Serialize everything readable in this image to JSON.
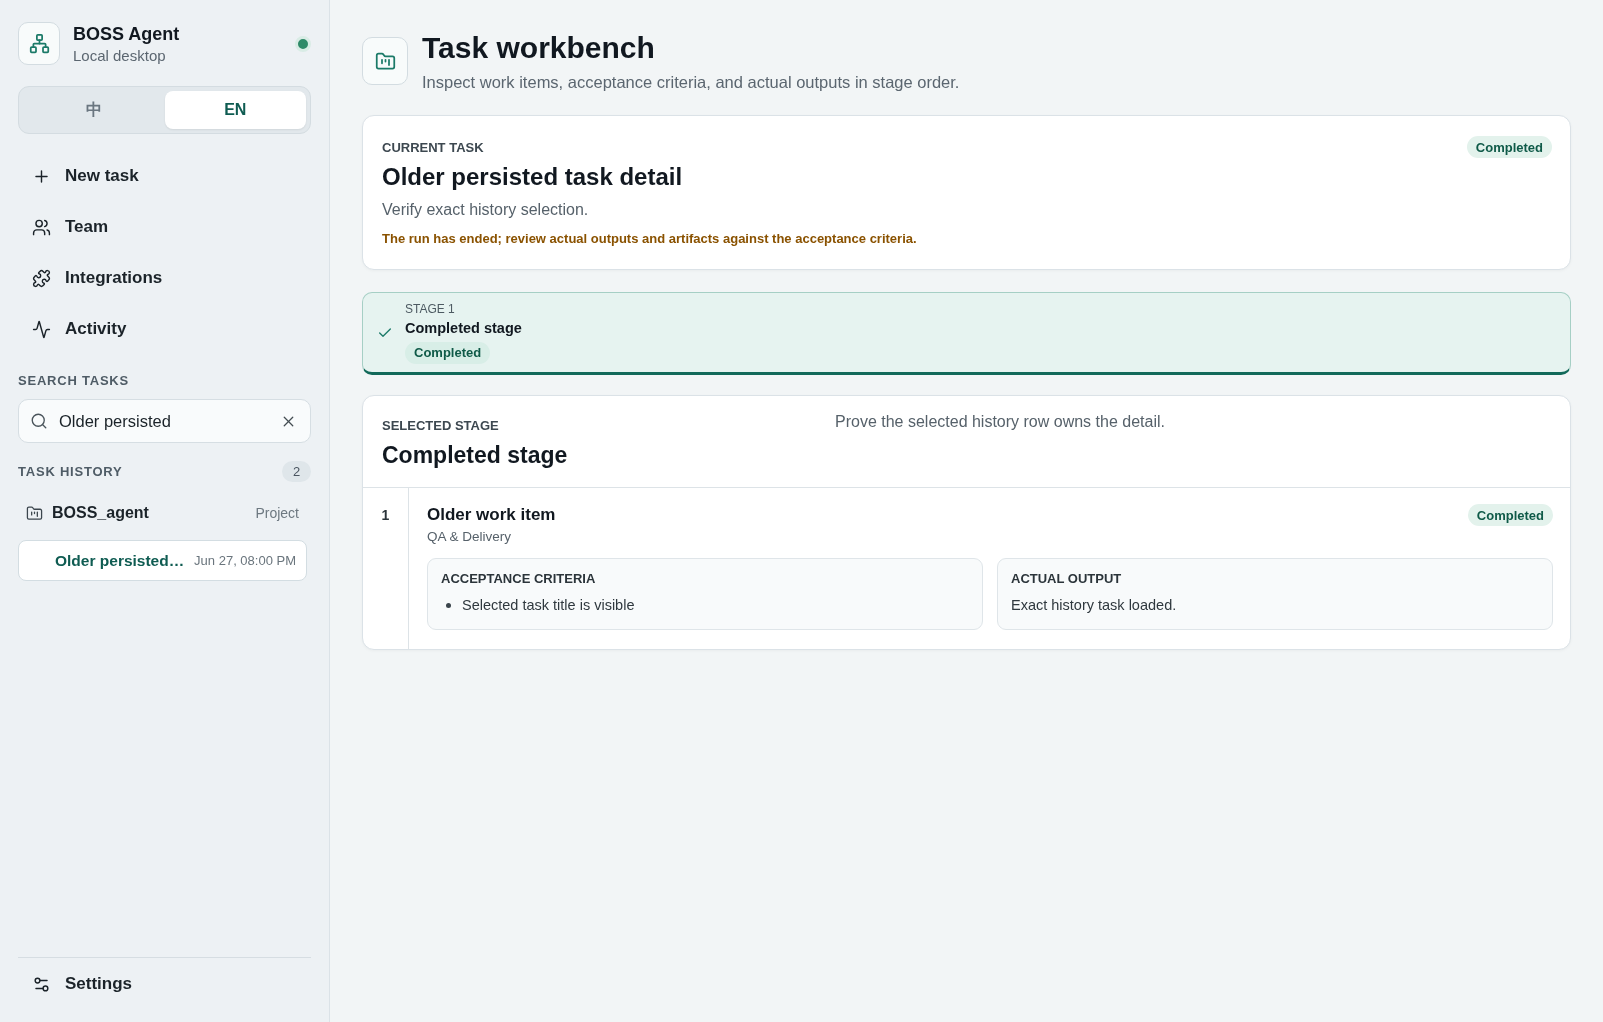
{
  "sidebar": {
    "brand": {
      "name": "BOSS Agent",
      "subtitle": "Local desktop",
      "online": true
    },
    "language_toggle": [
      {
        "label": "中",
        "selected": false
      },
      {
        "label": "EN",
        "selected": true
      }
    ],
    "nav": [
      {
        "label": "New task"
      },
      {
        "label": "Team"
      },
      {
        "label": "Integrations"
      },
      {
        "label": "Activity"
      }
    ],
    "search": {
      "label": "SEARCH TASKS",
      "value": "Older persisted"
    },
    "history": {
      "label": "TASK HISTORY",
      "count": "2",
      "project": {
        "name": "BOSS_agent",
        "tag": "Project"
      },
      "tasks": [
        {
          "title": "Older persisted…",
          "time": "Jun 27, 08:00 PM",
          "selected": true
        }
      ]
    },
    "settings": {
      "label": "Settings"
    }
  },
  "header": {
    "title": "Task workbench",
    "subtitle": "Inspect work items, acceptance criteria, and actual outputs in stage order."
  },
  "current_task": {
    "label": "CURRENT TASK",
    "title": "Older persisted task detail",
    "description": "Verify exact history selection.",
    "notice": "The run has ended; review actual outputs and artifacts against the acceptance criteria.",
    "status": "Completed"
  },
  "stages": [
    {
      "label": "STAGE 1",
      "title": "Completed stage",
      "status": "Completed",
      "selected": true,
      "done": true
    }
  ],
  "selected_stage": {
    "label": "SELECTED STAGE",
    "title": "Completed stage",
    "description": "Prove the selected history row owns the detail.",
    "work_items": [
      {
        "number": "1",
        "title": "Older work item",
        "team": "QA & Delivery",
        "status": "Completed",
        "criteria": {
          "label": "ACCEPTANCE CRITERIA",
          "items": [
            "Selected task title is visible"
          ]
        },
        "output": {
          "label": "ACTUAL OUTPUT",
          "text": "Exact history task loaded."
        }
      }
    ]
  }
}
